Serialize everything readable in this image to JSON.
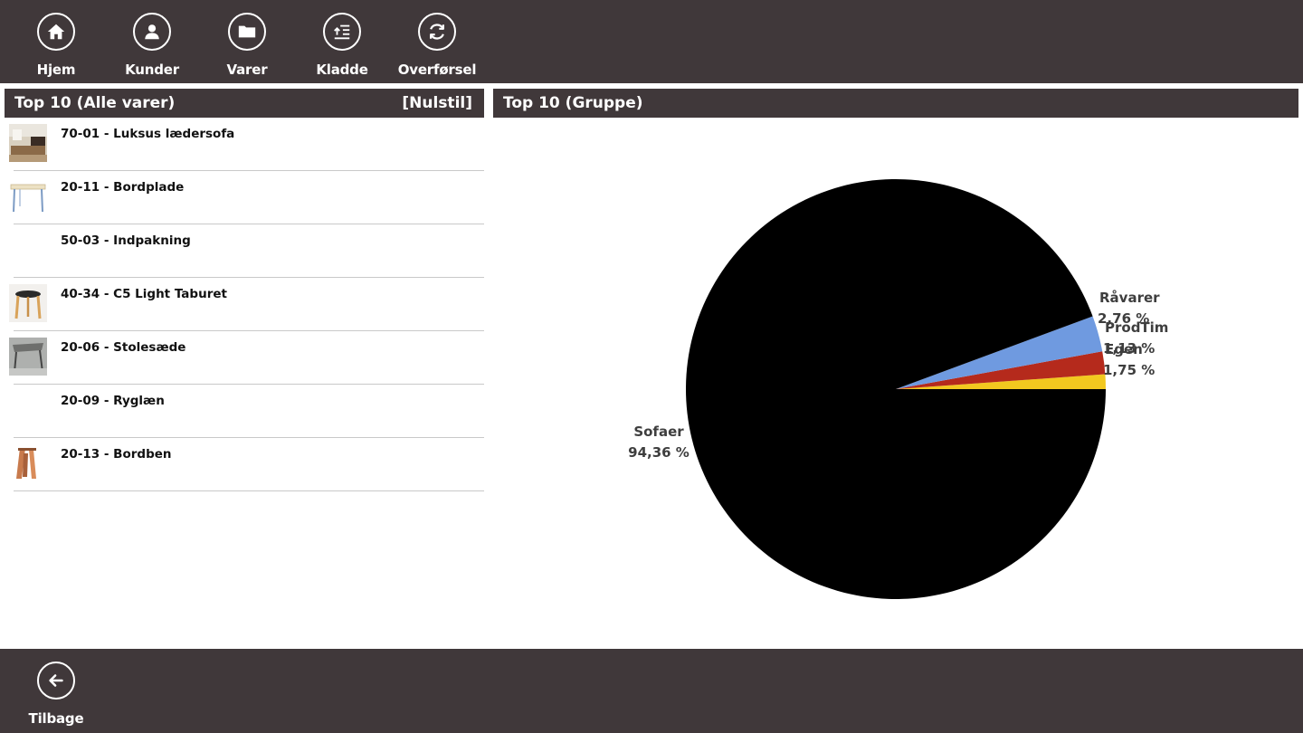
{
  "nav": {
    "items": [
      {
        "label": "Hjem",
        "icon": "home-icon"
      },
      {
        "label": "Kunder",
        "icon": "person-icon"
      },
      {
        "label": "Varer",
        "icon": "folder-icon"
      },
      {
        "label": "Kladde",
        "icon": "list-icon"
      },
      {
        "label": "Overførsel",
        "icon": "sync-icon"
      }
    ]
  },
  "left_panel": {
    "title": "Top 10 (Alle varer)",
    "reset_label": "[Nulstil]",
    "items": [
      {
        "label": "70-01 - Luksus lædersofa",
        "thumb": "sofa"
      },
      {
        "label": "20-11 - Bordplade",
        "thumb": "table"
      },
      {
        "label": "50-03 - Indpakning",
        "thumb": "none"
      },
      {
        "label": "40-34 - C5 Light Taburet",
        "thumb": "stool"
      },
      {
        "label": "20-06 - Stolesæde",
        "thumb": "chair"
      },
      {
        "label": "20-09 - Ryglæn",
        "thumb": "none"
      },
      {
        "label": "20-13 - Bordben",
        "thumb": "legs"
      }
    ]
  },
  "right_panel": {
    "title": "Top 10 (Gruppe)"
  },
  "chart_data": {
    "type": "pie",
    "slices": [
      {
        "name": "Sofaer",
        "value": 94.36,
        "label": "94,36 %",
        "color": "#000000"
      },
      {
        "name": "Råvarer",
        "value": 2.76,
        "label": "2,76 %",
        "color": "#6f9ae0"
      },
      {
        "name": "Egen",
        "value": 1.75,
        "label": "1,75 %",
        "color": "#b52a1c"
      },
      {
        "name": "ProdTim",
        "value": 1.13,
        "label": "1,13 %",
        "color": "#f2c81f"
      }
    ]
  },
  "bottom": {
    "back_label": "Tilbage"
  },
  "colors": {
    "bar": "#40383a",
    "divider": "#c9c9c9"
  }
}
